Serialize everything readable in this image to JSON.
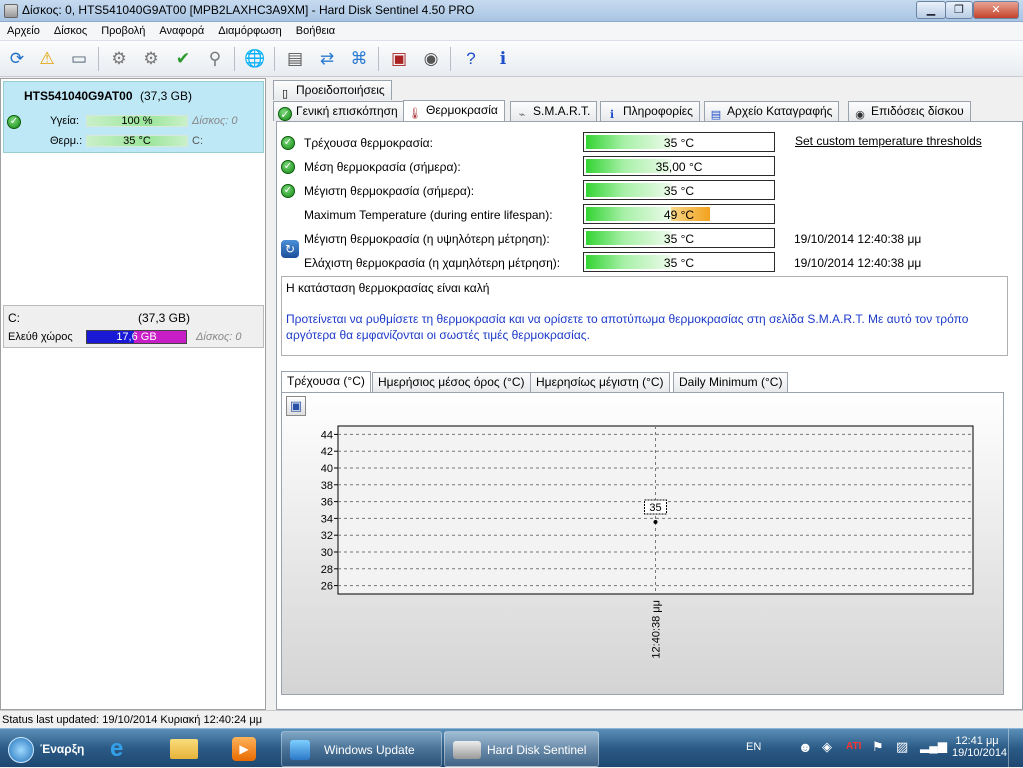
{
  "window": {
    "title": "Δίσκος: 0, HTS541040G9AT00 [MPB2LAXHC3A9XM] - Hard Disk Sentinel 4.50 PRO",
    "min": "▁",
    "max": "❐",
    "close": "✕"
  },
  "menu": [
    "Αρχείο",
    "Δίσκος",
    "Προβολή",
    "Αναφορά",
    "Διαμόρφωση",
    "Βοήθεια"
  ],
  "disk": {
    "name": "HTS541040G9AT00",
    "size": "(37,3 GB)",
    "health_label": "Υγεία:",
    "health_value": "100 %",
    "health_fraction": 1.0,
    "temp_label": "Θερμ.:",
    "temp_value": "35 °C",
    "disk_ref": "Δίσκος: 0",
    "vol_ref": "C:"
  },
  "volume": {
    "name": "C:",
    "size": "(37,3 GB)",
    "free_label": "Ελεύθ χώρος",
    "free_value": "17,6 GB",
    "free_fraction": 0.47,
    "disk_ref": "Δίσκος: 0"
  },
  "tabs_top": [
    "Προειδοποιήσεις"
  ],
  "tabs": [
    "Γενική επισκόπηση",
    "Θερμοκρασία",
    "S.M.A.R.T.",
    "Πληροφορίες",
    "Αρχείο Καταγραφής",
    "Επιδόσεις δίσκου"
  ],
  "temps": [
    {
      "label": "Τρέχουσα θερμοκρασία:",
      "value": "35 °C",
      "fill": 0.45,
      "ok": true,
      "side": "Set custom temperature thresholds"
    },
    {
      "label": "Μέση θερμοκρασία (σήμερα):",
      "value": "35,00 °C",
      "fill": 0.45,
      "ok": true,
      "side": ""
    },
    {
      "label": "Μέγιστη θερμοκρασία (σήμερα):",
      "value": "35 °C",
      "fill": 0.45,
      "ok": true,
      "side": ""
    },
    {
      "label": "Maximum Temperature (during entire lifespan):",
      "value": "49 °C",
      "fill": 0.66,
      "ok": false,
      "side": ""
    },
    {
      "label": "Μέγιστη θερμοκρασία (η υψηλότερη μέτρηση):",
      "value": "35 °C",
      "fill": 0.45,
      "ok": false,
      "side": "19/10/2014 12:40:38 μμ"
    },
    {
      "label": "Ελάχιστη θερμοκρασία (η χαμηλότερη μέτρηση):",
      "value": "35 °C",
      "fill": 0.45,
      "ok": false,
      "side": "19/10/2014 12:40:38 μμ"
    }
  ],
  "message": {
    "status": "Η κατάσταση θερμοκρασίας είναι καλή",
    "tip": "Προτείνεται να ρυθμίσετε τη θερμοκρασία και να ορίσετε το αποτύπωμα θερμοκρασίας στη σελίδα S.M.A.R.T. Με αυτό τον τρόπο αργότερα θα εμφανίζονται οι σωστές τιμές θερμοκρασίας."
  },
  "graph_tabs": [
    "Τρέχουσα (°C)",
    "Ημερήσιος μέσος όρος (°C)",
    "Ημερησίως μέγιστη (°C)",
    "Daily Minimum (°C)"
  ],
  "chart_data": {
    "type": "line",
    "x": [
      "12:40:38 μμ"
    ],
    "series": [
      {
        "values": [
          35
        ]
      }
    ],
    "yticks": [
      44,
      42,
      40,
      38,
      36,
      34,
      32,
      30,
      28,
      26
    ],
    "ylim": [
      25,
      45
    ],
    "grid": true,
    "point_label": "35"
  },
  "status": "Status last updated: 19/10/2014 Κυριακή 12:40:24 μμ",
  "taskbar": {
    "start": "Έναρξη",
    "apps": [
      "Windows Update",
      "Hard Disk Sentinel"
    ],
    "lang": "EN",
    "time": "12:41 μμ",
    "date": "19/10/2014"
  },
  "colors": {
    "ok": "#138a13",
    "tip": "#1c3ac7",
    "free_bar": "#1a1ad6",
    "used_bar": "#c81ec8"
  }
}
